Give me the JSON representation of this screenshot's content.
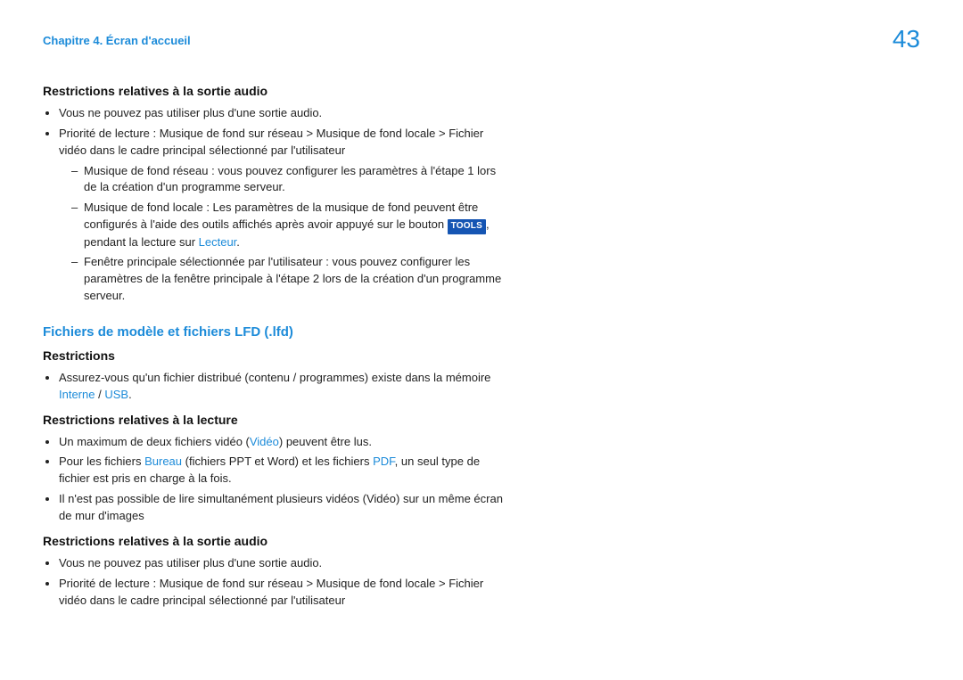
{
  "header": {
    "chapter": "Chapitre 4. Écran d'accueil",
    "page_number": "43"
  },
  "section1": {
    "heading": "Restrictions relatives à la sortie audio",
    "b1": "Vous ne pouvez pas utiliser plus d'une sortie audio.",
    "b2": "Priorité de lecture : Musique de fond sur réseau > Musique de fond locale > Fichier vidéo dans le cadre principal sélectionné par l'utilisateur",
    "d1": "Musique de fond réseau : vous pouvez configurer les paramètres à l'étape 1 lors de la création d'un programme serveur.",
    "d2_pre": "Musique de fond locale : Les paramètres de la musique de fond peuvent être configurés à l'aide des outils affichés après avoir appuyé sur le bouton ",
    "d2_badge": "TOOLS",
    "d2_mid": ", pendant la lecture sur ",
    "d2_hl": "Lecteur",
    "d2_post": ".",
    "d3": "Fenêtre principale sélectionnée par l'utilisateur : vous pouvez configurer les paramètres de la fenêtre principale à l'étape 2 lors de la création d'un programme serveur."
  },
  "section2": {
    "heading": "Fichiers de modèle et fichiers LFD (.lfd)",
    "sub1": "Restrictions",
    "s1b1_pre": "Assurez-vous qu'un fichier distribué (contenu / programmes) existe dans la mémoire ",
    "s1b1_hl1": "Interne",
    "s1b1_mid": " / ",
    "s1b1_hl2": "USB",
    "s1b1_post": ".",
    "sub2": "Restrictions relatives à la lecture",
    "s2b1_pre": "Un maximum de deux fichiers vidéo (",
    "s2b1_hl": "Vidéo",
    "s2b1_post": ") peuvent être lus.",
    "s2b2_pre": "Pour les fichiers ",
    "s2b2_hl1": "Bureau",
    "s2b2_mid": " (fichiers PPT et Word) et les fichiers ",
    "s2b2_hl2": "PDF",
    "s2b2_post": ", un seul type de fichier est pris en charge à la fois.",
    "s2b3": "Il n'est pas possible de lire simultanément plusieurs vidéos (Vidéo) sur un même écran de mur d'images",
    "sub3": "Restrictions relatives à la sortie audio",
    "s3b1": "Vous ne pouvez pas utiliser plus d'une sortie audio.",
    "s3b2": "Priorité de lecture : Musique de fond sur réseau > Musique de fond locale > Fichier vidéo dans le cadre principal sélectionné par l'utilisateur"
  }
}
